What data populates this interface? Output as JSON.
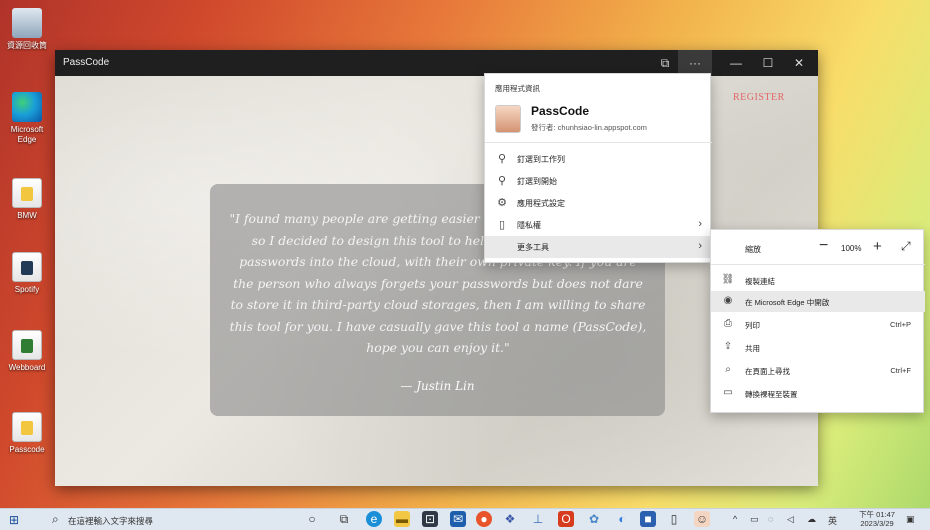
{
  "desktop": {
    "icons": [
      {
        "label": "資源回收筒",
        "icon": "recycle-bin-icon"
      },
      {
        "label": "Microsoft Edge",
        "icon": "edge-icon"
      },
      {
        "label": "BMW",
        "icon": "file-icon"
      },
      {
        "label": "Spotify",
        "icon": "file-icon"
      },
      {
        "label": "Webboard",
        "icon": "file-icon"
      },
      {
        "label": "Passcode",
        "icon": "file-icon"
      }
    ]
  },
  "window": {
    "title": "PassCode",
    "buttons": {
      "app": "⧉",
      "more": "···",
      "minimize": "—",
      "maximize": "☐",
      "close": "✕"
    },
    "register": "REGISTER",
    "quote": "\"I found many people are getting easier to forget their passwords, so I decided to design this tool to help people to store their passwords into the cloud, with their own private key. If you are the person who always forgets your passwords but does not dare to store it in third-party cloud storages, then I am willing to share this tool for you. I have casually gave this tool a name (PassCode), hope you can enjoy it.\"",
    "author": "— Justin Lin"
  },
  "menu": {
    "header": "應用程式資訊",
    "app_name": "PassCode",
    "app_publisher": "發行者: chunhsiao-lin.appspot.com",
    "items": [
      {
        "label": "釘選到工作列",
        "icon": "pin-icon"
      },
      {
        "label": "釘選到開始",
        "icon": "pin-icon"
      },
      {
        "label": "應用程式設定",
        "icon": "settings-icon"
      },
      {
        "label": "隱私權",
        "icon": "privacy-icon"
      },
      {
        "label": "更多工具",
        "icon": ""
      }
    ]
  },
  "submenu": {
    "zoom_label": "縮放",
    "zoom_value": "100%",
    "items": [
      {
        "label": "複製連結",
        "shortcut": ""
      },
      {
        "label": "在 Microsoft Edge 中開啟",
        "shortcut": ""
      },
      {
        "label": "列印",
        "shortcut": "Ctrl+P"
      },
      {
        "label": "共用",
        "shortcut": ""
      },
      {
        "label": "在頁面上尋找",
        "shortcut": "Ctrl+F"
      },
      {
        "label": "轉換裸程至裝置",
        "shortcut": ""
      }
    ]
  },
  "taskbar": {
    "search_placeholder": "在這裡輸入文字來搜尋",
    "clock_time": "下午 01:47",
    "clock_date": "2023/3/29",
    "input_method": "英"
  },
  "colors": {
    "register": "#e26767",
    "titlebar": "#1f1f1f"
  }
}
